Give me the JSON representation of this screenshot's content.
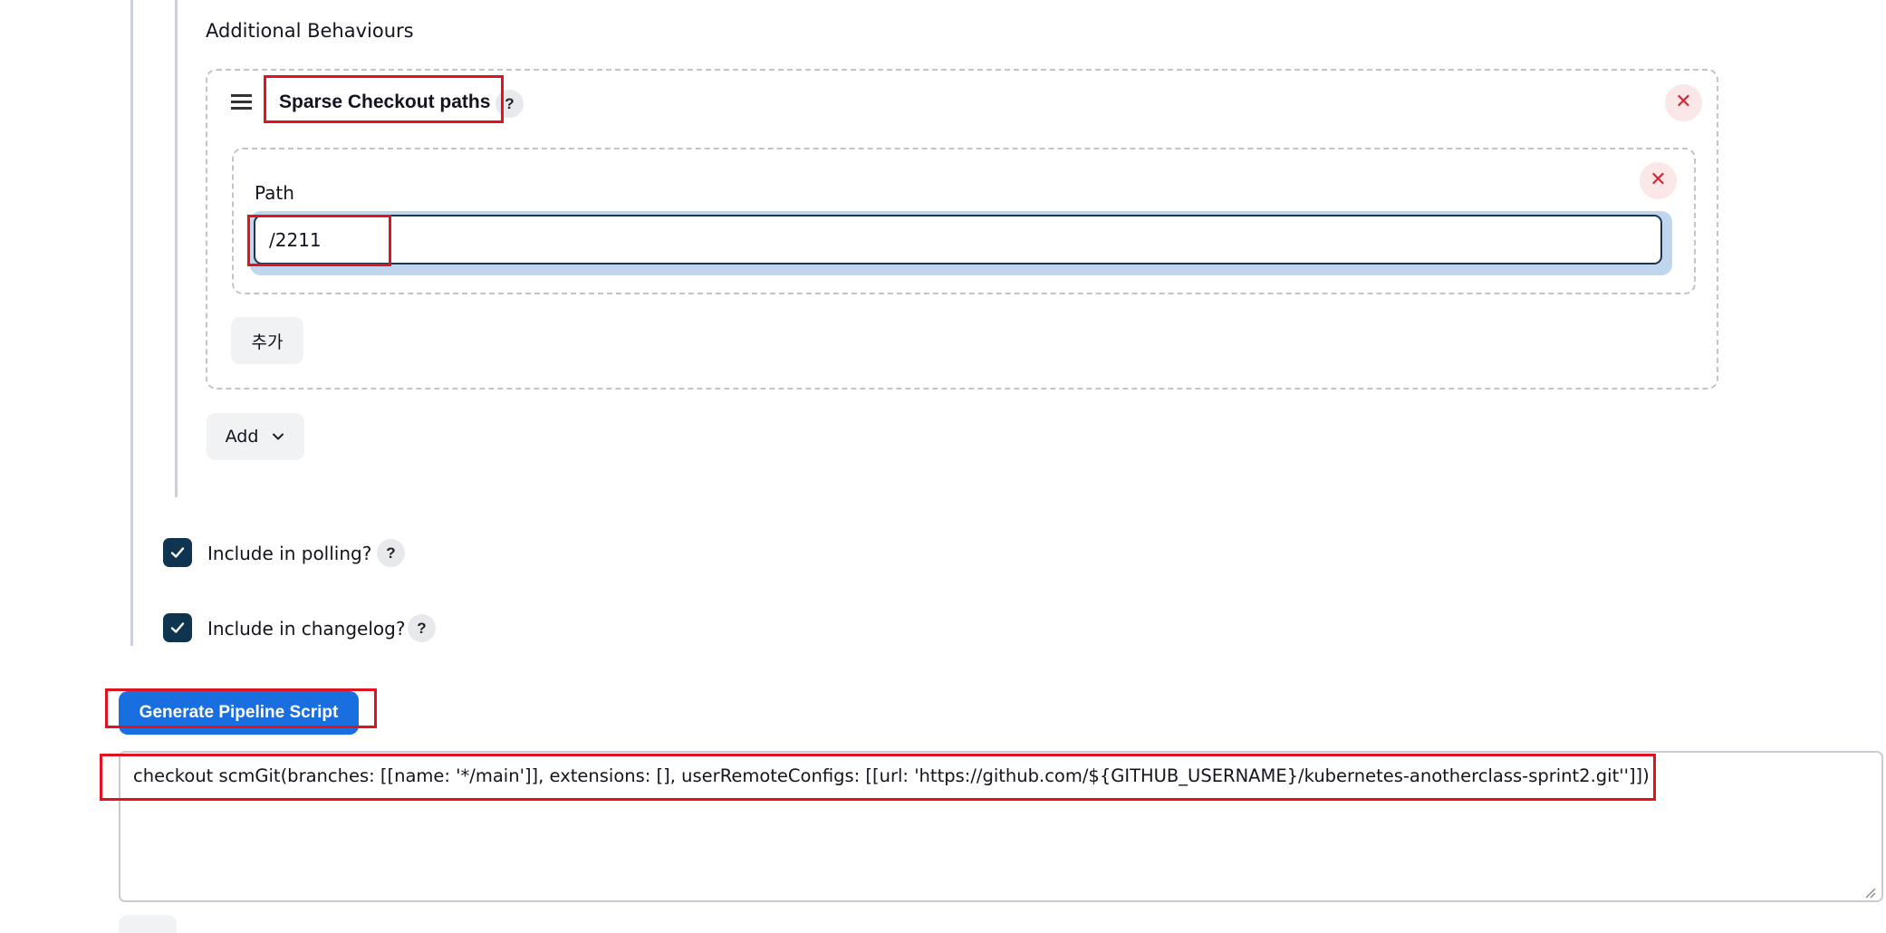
{
  "section": {
    "title": "Additional Behaviours"
  },
  "sparse_checkout": {
    "title": "Sparse Checkout paths",
    "help": "?",
    "remove": "✕",
    "path_entry": {
      "label": "Path",
      "value": "/2211",
      "remove": "✕"
    },
    "add_path_label": "추가"
  },
  "add_behaviour": {
    "label": "Add"
  },
  "options": [
    {
      "label": "Include in polling?",
      "checked": true,
      "help": "?"
    },
    {
      "label": "Include in changelog?",
      "checked": true,
      "help": "?"
    }
  ],
  "generate": {
    "label": "Generate Pipeline Script"
  },
  "script_output": "checkout scmGit(branches: [[name: '*/main']], extensions: [], userRemoteConfigs: [[url: 'https://github.com/${GITHUB_USERNAME}/kubernetes-anotherclass-sprint2.git'']])",
  "colors": {
    "accent_blue": "#1a6fe0",
    "checkbox_dark": "#0e3450",
    "annotation_red": "#e0141e",
    "remove_red": "#d62433"
  },
  "icons": {
    "drag_handle": "drag-handle-icon",
    "remove": "close-icon",
    "dropdown": "chevron-down-icon",
    "check": "check-icon"
  }
}
